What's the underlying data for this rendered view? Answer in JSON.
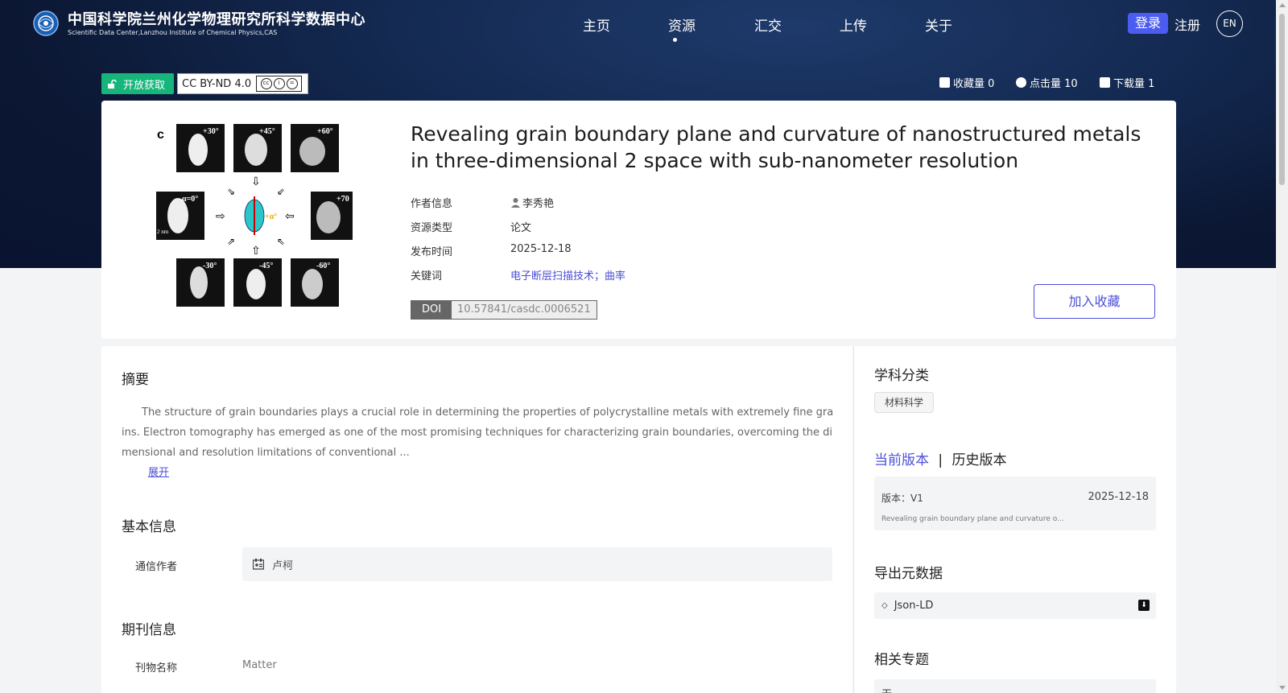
{
  "header": {
    "site_name": "中国科学院兰州化学物理研究所科学数据中心",
    "site_subtitle": "Scientific Data Center,Lanzhou Institute of Chemical Physics,CAS",
    "nav": [
      "主页",
      "资源",
      "汇交",
      "上传",
      "关于"
    ],
    "active_nav": "资源",
    "login": "登录",
    "register": "注册",
    "lang": "EN"
  },
  "badges": {
    "open_access": "开放获取",
    "license": "CC BY-ND 4.0"
  },
  "stats": {
    "favorites": "收藏量 0",
    "views": "点击量 10",
    "downloads": "下载量 1"
  },
  "figure": {
    "panel_label": "c",
    "top_angles": [
      "+30°",
      "+45°",
      "+60°"
    ],
    "left_angle": "α=0°",
    "right_angle": "+70",
    "center_angle": "+α°",
    "scale": "2 nm",
    "bottom_angles": [
      "-30°",
      "-45°",
      "-60°"
    ]
  },
  "resource": {
    "title": "Revealing grain boundary plane and curvature of nanostructured metals in three-dimensional 2 space with sub-nanometer resolution",
    "author_label": "作者信息",
    "author": "李秀艳",
    "type_label": "资源类型",
    "type": "论文",
    "date_label": "发布时间",
    "date": "2025-12-18",
    "keywords_label": "关键词",
    "keywords": "电子断层扫描技术；曲率",
    "doi_label": "DOI",
    "doi": "10.57841/casdc.0006521",
    "fav_button": "加入收藏"
  },
  "abstract": {
    "heading": "摘要",
    "text": "The structure of grain boundaries plays a crucial role in determining the properties of polycrystalline metals with extremely fine grains. Electron tomography has emerged as one of the most promising techniques for characterizing grain boundaries, overcoming the dimensional and resolution limitations of conventional ...",
    "expand": "展开"
  },
  "basic_info": {
    "heading": "基本信息",
    "corresponding_label": "通信作者",
    "corresponding": "卢柯"
  },
  "journal_info": {
    "heading": "期刊信息",
    "name_label": "刊物名称",
    "name": "Matter"
  },
  "sidebar": {
    "subject_heading": "学科分类",
    "subject_tag": "材料科学",
    "current_version": "当前版本",
    "version_sep": "|",
    "history_version": "历史版本",
    "version_label": "版本：V1",
    "version_date": "2025-12-18",
    "version_summary": "Revealing grain boundary plane and curvature o...",
    "export_heading": "导出元数据",
    "export_format": "Json-LD",
    "related_heading": "相关专题",
    "related_value": "无"
  },
  "colors": {
    "accent": "#4b4fd8",
    "open_green": "#16b57a",
    "hero_dark": "#0b1733"
  }
}
